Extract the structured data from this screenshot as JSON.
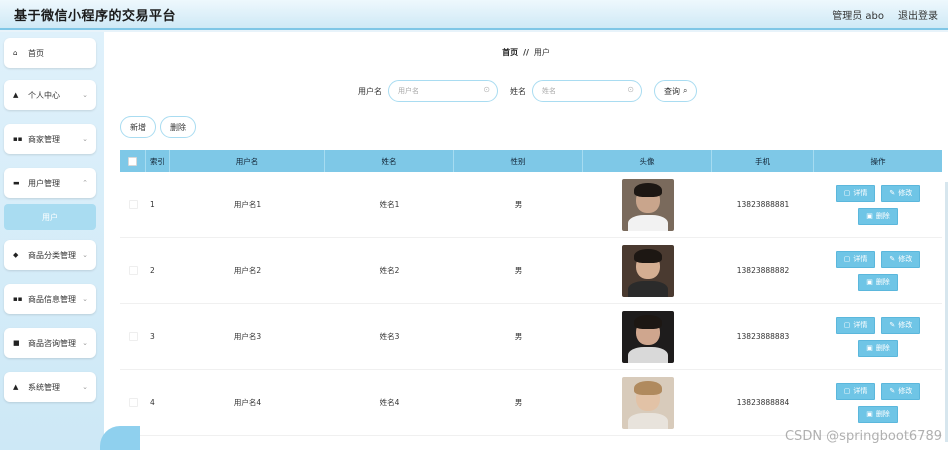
{
  "header": {
    "title": "基于微信小程序的交易平台",
    "user_label": "管理员 abo",
    "logout_label": "退出登录"
  },
  "sidebar": {
    "items": [
      {
        "label": "首页",
        "icon": "home-icon",
        "glyph": "⌂",
        "has_chevron": false
      },
      {
        "label": "个人中心",
        "icon": "user-icon",
        "glyph": "▲",
        "has_chevron": true
      },
      {
        "label": "商家管理",
        "icon": "grid-icon",
        "glyph": "▪▪",
        "has_chevron": true
      },
      {
        "label": "用户管理",
        "icon": "monitor-icon",
        "glyph": "▬",
        "has_chevron": true
      },
      {
        "label": "商品分类管理",
        "icon": "tag-icon",
        "glyph": "◆",
        "has_chevron": true
      },
      {
        "label": "商品信息管理",
        "icon": "grid-icon",
        "glyph": "▪▪",
        "has_chevron": true
      },
      {
        "label": "商品咨询管理",
        "icon": "doc-icon",
        "glyph": "■",
        "has_chevron": true
      },
      {
        "label": "系统管理",
        "icon": "user-icon",
        "glyph": "▲",
        "has_chevron": true
      }
    ],
    "active_sub": "用户"
  },
  "breadcrumb": {
    "home": "首页",
    "separator": "//",
    "current": "用户"
  },
  "search": {
    "username_label": "用户名",
    "username_placeholder": "用户名",
    "name_label": "姓名",
    "name_placeholder": "姓名",
    "query_label": "查询"
  },
  "ops": {
    "add_label": "新增",
    "delete_label": "删除"
  },
  "table": {
    "headers": {
      "index": "索引",
      "username": "用户名",
      "name": "姓名",
      "gender": "性别",
      "avatar": "头像",
      "phone": "手机",
      "action": "操作"
    },
    "rows": [
      {
        "index": "1",
        "username": "用户名1",
        "name": "姓名1",
        "gender": "男",
        "phone": "13823888881"
      },
      {
        "index": "2",
        "username": "用户名2",
        "name": "姓名2",
        "gender": "男",
        "phone": "13823888882"
      },
      {
        "index": "3",
        "username": "用户名3",
        "name": "姓名3",
        "gender": "男",
        "phone": "13823888883"
      },
      {
        "index": "4",
        "username": "用户名4",
        "name": "姓名4",
        "gender": "男",
        "phone": "13823888884"
      }
    ],
    "action_labels": {
      "detail": "详情",
      "edit": "修改",
      "delete": "删除"
    }
  },
  "watermark": "CSDN @springboot6789",
  "colors": {
    "accent": "#7ec8e7",
    "action_button": "#6fc5e6",
    "sidebar_bg": "#dff1fb",
    "active_sub_bg": "#a9dcf1"
  }
}
